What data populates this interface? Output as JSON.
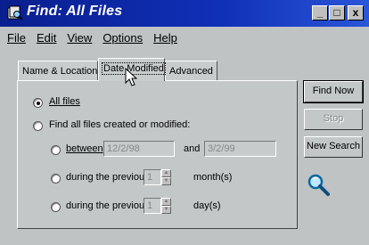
{
  "window": {
    "title": "Find: All Files",
    "controls": {
      "minimize": "_",
      "maximize": "□",
      "close": "x"
    }
  },
  "menu": [
    {
      "label": "File"
    },
    {
      "label": "Edit"
    },
    {
      "label": "View"
    },
    {
      "label": "Options"
    },
    {
      "label": "Help"
    }
  ],
  "tabs": [
    {
      "label": "Name & Location"
    },
    {
      "label": "Date Modified"
    },
    {
      "label": "Advanced"
    }
  ],
  "date_tab": {
    "all_files": "All files",
    "find_created_modified": "Find all files created or modified:",
    "between": "between",
    "and": "and",
    "between_start": "12/2/98",
    "between_end": "3/2/99",
    "during_prev_months_label": "during the previous",
    "months_value": "1",
    "months_unit": "month(s)",
    "during_prev_days_label": "during the previous",
    "days_value": "1",
    "days_unit": "day(s)"
  },
  "buttons": {
    "find_now": "Find Now",
    "stop": "Stop",
    "new_search": "New Search"
  },
  "icons": {
    "title_icon": "find-files-icon",
    "search": "magnifier-icon",
    "cursor": "mouse-pointer-icon"
  }
}
